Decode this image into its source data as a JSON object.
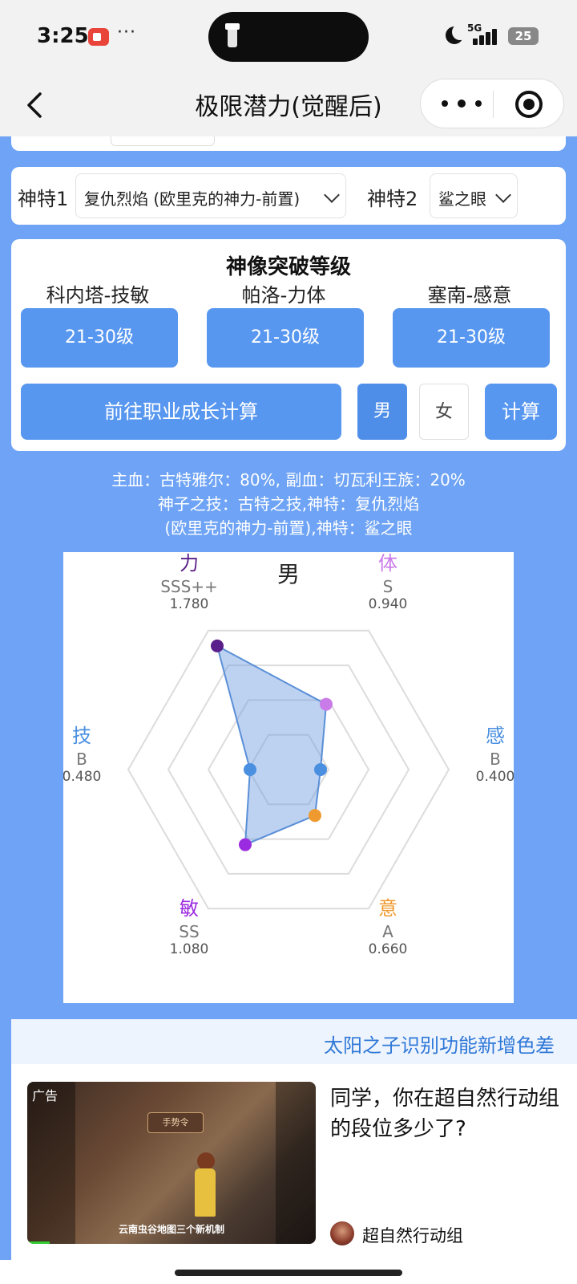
{
  "status_bar": {
    "time": "3:25",
    "network": "5G",
    "battery": "25",
    "dots": "···"
  },
  "nav": {
    "title": "极限潜力(觉醒后)"
  },
  "shente": {
    "label1": "神特1",
    "value1": "复仇烈焰 (欧里克的神力-前置)",
    "label2": "神特2",
    "value2": "鲨之眼"
  },
  "breakthrough": {
    "title": "神像突破等级",
    "columns": [
      {
        "label": "科内塔-技敏",
        "value": "21-30级"
      },
      {
        "label": "帕洛-力体",
        "value": "21-30级"
      },
      {
        "label": "塞南-感意",
        "value": "21-30级"
      }
    ],
    "go_button": "前往职业成长计算",
    "male": "男",
    "female": "女",
    "calc": "计算"
  },
  "summary": {
    "line1": "主血：古特雅尔：80%, 副血：切瓦利王族：20%",
    "line2": "神子之技：古特之技,神特：复仇烈焰",
    "line3": "(欧里克的神力-前置),神特：鲨之眼"
  },
  "chart_data": {
    "type": "radar",
    "title": "男",
    "axes": [
      {
        "name": "力",
        "grade": "SSS++",
        "value": 1.78,
        "color": "#5a1f8a"
      },
      {
        "name": "体",
        "grade": "S",
        "value": 0.94,
        "color": "#c97be8"
      },
      {
        "name": "感",
        "grade": "B",
        "value": 0.4,
        "color": "#4a8fe0"
      },
      {
        "name": "意",
        "grade": "A",
        "value": 0.66,
        "color": "#ef9a2e"
      },
      {
        "name": "敏",
        "grade": "SS",
        "value": 1.08,
        "color": "#9b2be0"
      },
      {
        "name": "技",
        "grade": "B",
        "value": 0.48,
        "color": "#4a8fe0"
      }
    ],
    "value_labels": [
      "1.780",
      "0.940",
      "0.400",
      "0.660",
      "1.080",
      "0.480"
    ],
    "max": 2.0,
    "rings": 4,
    "fill_color": "#6c9be0"
  },
  "ad": {
    "marquee": "太阳之子识别功能新增色差",
    "tag": "广告",
    "sign": "手势令",
    "caption": "云南虫谷地图三个新机制",
    "title": "同学，你在超自然行动组的段位多少了?",
    "source": "超自然行动组"
  }
}
